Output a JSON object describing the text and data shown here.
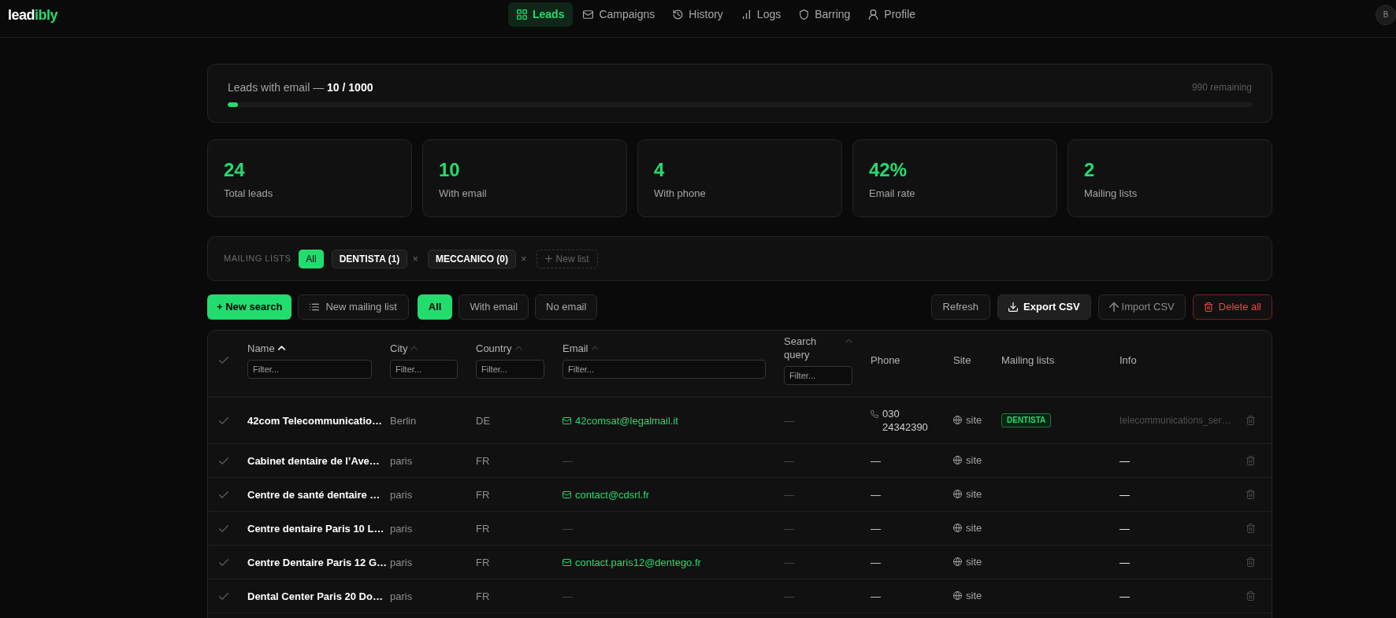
{
  "nav": {
    "logo": [
      {
        "text": "lead",
        "color": "#ffffff"
      },
      {
        "text": "ibly",
        "color": "#22dd6e"
      }
    ],
    "items": [
      {
        "label": "Leads",
        "selected": true
      },
      {
        "label": "Campaigns",
        "selected": false
      },
      {
        "label": "History",
        "selected": false
      },
      {
        "label": "Logs",
        "selected": false
      },
      {
        "label": "Barring",
        "selected": false
      },
      {
        "label": "Profile",
        "selected": false
      }
    ],
    "avatar": "B"
  },
  "progress": {
    "label": "Leads with email — **10 / 1000**",
    "remaining": "990 remaining",
    "level": 0.01
  },
  "stats": [
    {
      "value": "24",
      "label": "Total leads"
    },
    {
      "value": "10",
      "label": "With email"
    },
    {
      "value": "4",
      "label": "With phone"
    },
    {
      "value": "42%",
      "label": "Email rate"
    },
    {
      "value": "2",
      "label": "Mailing lists"
    }
  ],
  "mailing_lists": {
    "label": "MAILING LISTS",
    "chips": [
      {
        "label": "All",
        "selected": true
      },
      {
        "label": "DENTISTA (1)",
        "selected": false,
        "remove": "×"
      },
      {
        "label": "MECCANICO (0)",
        "selected": false,
        "remove": "×"
      }
    ],
    "new_list": "New list"
  },
  "toolbar": {
    "actions": [
      {
        "label": "+ New search",
        "kind": "primary"
      },
      {
        "label": "New mailing list",
        "kind": "outline"
      }
    ],
    "filters": [
      {
        "label": "All",
        "selected": true
      },
      {
        "label": "With email",
        "selected": false
      },
      {
        "label": "No email",
        "selected": false
      }
    ],
    "tools": [
      {
        "label": "Refresh",
        "kind": "outline"
      },
      {
        "label": "Export CSV",
        "kind": "solid"
      },
      {
        "label": "Import CSV",
        "kind": "muted"
      },
      {
        "label": "Delete all",
        "kind": "danger"
      }
    ]
  },
  "table": {
    "columns": [
      {
        "label": "Name",
        "sortable": true,
        "sorted": true,
        "filter_placeholder": "Filter..."
      },
      {
        "label": "City",
        "sortable": true,
        "sorted": false,
        "filter_placeholder": "Filter..."
      },
      {
        "label": "Country",
        "sortable": true,
        "sorted": false,
        "filter_placeholder": "Filter..."
      },
      {
        "label": "Email",
        "sortable": true,
        "sorted": false,
        "filter_placeholder": "Filter..."
      },
      {
        "label": "Search query",
        "sortable": true,
        "sorted": false,
        "filter_placeholder": "Filter..."
      },
      {
        "label": "Phone",
        "sortable": false,
        "sorted": false
      },
      {
        "label": "Site",
        "sortable": false,
        "sorted": false
      },
      {
        "label": "Mailing lists",
        "sortable": false,
        "sorted": false
      },
      {
        "label": "Info",
        "sortable": false,
        "sorted": false
      }
    ],
    "rows": [
      {
        "name": "42com Telecommunicatio…",
        "city": "Berlin",
        "country": "DE",
        "email": {
          "kind": "link",
          "text": "42comsat@legalmail.it"
        },
        "search_query": "—",
        "phone": {
          "kind": "number",
          "text": "030 24342390"
        },
        "site": "site",
        "mailing_lists": [
          "DENTISTA"
        ],
        "info": {
          "kind": "note",
          "text": "telecommunications_ser…"
        }
      },
      {
        "name": "Cabinet dentaire de l’Ave…",
        "city": "paris",
        "country": "FR",
        "email": {
          "kind": "empty",
          "text": "—"
        },
        "search_query": "—",
        "phone": {
          "kind": "empty",
          "text": "—"
        },
        "site": "site",
        "info": {
          "kind": "empty",
          "text": "—"
        }
      },
      {
        "name": "Centre de santé dentaire …",
        "city": "paris",
        "country": "FR",
        "email": {
          "kind": "link",
          "text": "contact@cdsrl.fr"
        },
        "search_query": "—",
        "phone": {
          "kind": "empty",
          "text": "—"
        },
        "site": "site",
        "info": {
          "kind": "empty",
          "text": "—"
        }
      },
      {
        "name": "Centre dentaire Paris 10 L…",
        "city": "paris",
        "country": "FR",
        "email": {
          "kind": "empty",
          "text": "—"
        },
        "search_query": "—",
        "phone": {
          "kind": "empty",
          "text": "—"
        },
        "site": "site",
        "info": {
          "kind": "empty",
          "text": "—"
        }
      },
      {
        "name": "Centre Dentaire Paris 12 G…",
        "city": "paris",
        "country": "FR",
        "email": {
          "kind": "link",
          "text": "contact.paris12@dentego.fr"
        },
        "search_query": "—",
        "phone": {
          "kind": "empty",
          "text": "—"
        },
        "site": "site",
        "info": {
          "kind": "empty",
          "text": "—"
        }
      },
      {
        "name": "Dental Center Paris 20 Do…",
        "city": "paris",
        "country": "FR",
        "email": {
          "kind": "empty",
          "text": "—"
        },
        "search_query": "—",
        "phone": {
          "kind": "empty",
          "text": "—"
        },
        "site": "site",
        "info": {
          "kind": "empty",
          "text": "—"
        }
      }
    ]
  }
}
